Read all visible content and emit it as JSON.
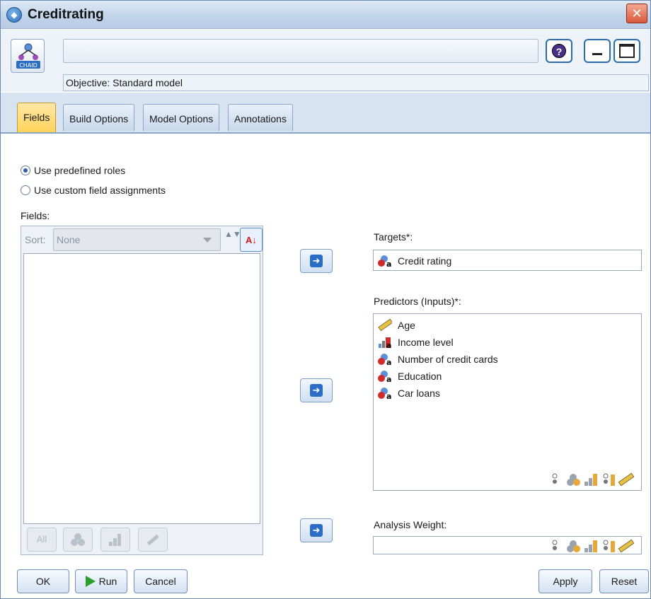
{
  "window": {
    "title": "Creditrating",
    "close_glyph": "✕"
  },
  "header": {
    "node_icon": "chaid-node-icon",
    "node_icon_label": "CHAID",
    "name_value": "",
    "help_glyph": "?",
    "objective": "Objective: Standard model"
  },
  "tabs": [
    {
      "label": "Fields",
      "active": true
    },
    {
      "label": "Build Options",
      "active": false
    },
    {
      "label": "Model Options",
      "active": false
    },
    {
      "label": "Annotations",
      "active": false
    }
  ],
  "roles": {
    "predefined": "Use predefined roles",
    "custom": "Use custom field assignments",
    "selected": "predefined"
  },
  "fields": {
    "label": "Fields:",
    "sort_label": "Sort:",
    "sort_value": "None",
    "sort_updown_glyph": "▲▼",
    "sort_az_glyph": "A↓",
    "all_label": "All",
    "items": []
  },
  "targets": {
    "label": "Targets*:",
    "items": [
      {
        "name": "Credit rating",
        "type": "nominal"
      }
    ]
  },
  "predictors": {
    "label": "Predictors (Inputs)*:",
    "items": [
      {
        "name": "Age",
        "type": "continuous"
      },
      {
        "name": "Income level",
        "type": "ordinal"
      },
      {
        "name": "Number of credit cards",
        "type": "nominal"
      },
      {
        "name": "Education",
        "type": "nominal"
      },
      {
        "name": "Car loans",
        "type": "nominal"
      }
    ]
  },
  "weight": {
    "label": "Analysis Weight:",
    "value": ""
  },
  "buttons": {
    "move_glyph": "➜",
    "ok": "OK",
    "run": "Run",
    "cancel": "Cancel",
    "apply": "Apply",
    "reset": "Reset"
  },
  "colors": {
    "active_tab": "#ffd35a",
    "accent": "#2b6cc4",
    "tab_strip": "#d7e3f1"
  }
}
